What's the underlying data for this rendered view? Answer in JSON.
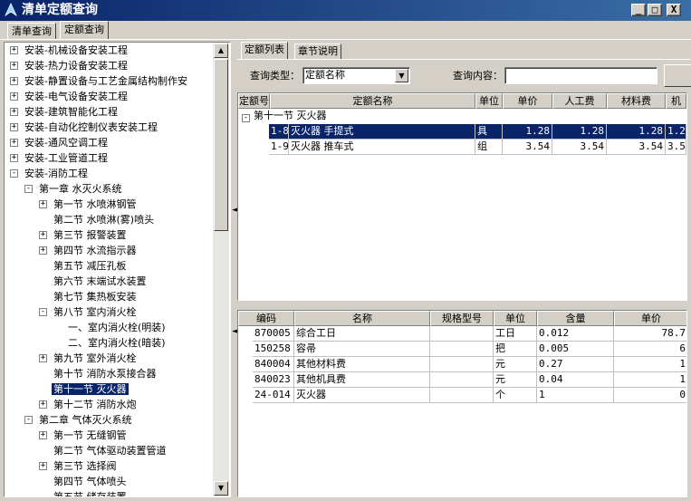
{
  "window": {
    "title": "清单定额查询",
    "buttons": {
      "minimize": "_",
      "maximize": "□",
      "close": "X"
    }
  },
  "top_tabs": [
    "清单查询",
    "定额查询"
  ],
  "tree": {
    "items": [
      {
        "label": "安装-机械设备安装工程",
        "level": 0,
        "exp": "+"
      },
      {
        "label": "安装-热力设备安装工程",
        "level": 0,
        "exp": "+"
      },
      {
        "label": "安装-静置设备与工艺金属结构制作安",
        "level": 0,
        "exp": "+"
      },
      {
        "label": "安装-电气设备安装工程",
        "level": 0,
        "exp": "+"
      },
      {
        "label": "安装-建筑智能化工程",
        "level": 0,
        "exp": "+"
      },
      {
        "label": "安装-自动化控制仪表安装工程",
        "level": 0,
        "exp": "+"
      },
      {
        "label": "安装-通风空调工程",
        "level": 0,
        "exp": "+"
      },
      {
        "label": "安装-工业管道工程",
        "level": 0,
        "exp": "+"
      },
      {
        "label": "安装-消防工程",
        "level": 0,
        "exp": "-"
      },
      {
        "label": "第一章 水灭火系统",
        "level": 1,
        "exp": "-"
      },
      {
        "label": "第一节 水喷淋钢管",
        "level": 2,
        "exp": "+"
      },
      {
        "label": "第二节 水喷淋(雾)喷头",
        "level": 2,
        "exp": ""
      },
      {
        "label": "第三节 报警装置",
        "level": 2,
        "exp": "+"
      },
      {
        "label": "第四节 水流指示器",
        "level": 2,
        "exp": "+"
      },
      {
        "label": "第五节 减压孔板",
        "level": 2,
        "exp": ""
      },
      {
        "label": "第六节 末端试水装置",
        "level": 2,
        "exp": ""
      },
      {
        "label": "第七节 集热板安装",
        "level": 2,
        "exp": ""
      },
      {
        "label": "第八节 室内消火栓",
        "level": 2,
        "exp": "-"
      },
      {
        "label": "一、室内消火栓(明装)",
        "level": 3,
        "exp": ""
      },
      {
        "label": "二、室内消火栓(暗装)",
        "level": 3,
        "exp": ""
      },
      {
        "label": "第九节 室外消火栓",
        "level": 2,
        "exp": "+"
      },
      {
        "label": "第十节 消防水泵接合器",
        "level": 2,
        "exp": ""
      },
      {
        "label": "第十一节 灭火器",
        "level": 2,
        "exp": "",
        "selected": true
      },
      {
        "label": "第十二节 消防水炮",
        "level": 2,
        "exp": "+"
      },
      {
        "label": "第二章 气体灭火系统",
        "level": 1,
        "exp": "-"
      },
      {
        "label": "第一节 无缝钢管",
        "level": 2,
        "exp": "+"
      },
      {
        "label": "第二节 气体驱动装置管道",
        "level": 2,
        "exp": ""
      },
      {
        "label": "第三节 选择阀",
        "level": 2,
        "exp": "+"
      },
      {
        "label": "第四节 气体喷头",
        "level": 2,
        "exp": ""
      },
      {
        "label": "第五节 储存装置",
        "level": 2,
        "exp": ""
      }
    ]
  },
  "right_tabs": [
    "定额列表",
    "章节说明"
  ],
  "query": {
    "type_label": "查询类型：",
    "type_value": "定额名称",
    "content_label": "查询内容：",
    "content_value": ""
  },
  "quota_grid": {
    "headers": [
      "定额号",
      "定额名称",
      "单位",
      "单价",
      "人工费",
      "材料费",
      "机"
    ],
    "group_label": "第十一节 灭火器",
    "rows": [
      {
        "code": "1-8",
        "name": "灭火器 手提式",
        "unit": "具",
        "price": "1.28",
        "labor": "1.28",
        "material": "1.28",
        "machine": "1.2",
        "selected": true
      },
      {
        "code": "1-9",
        "name": "灭火器 推车式",
        "unit": "组",
        "price": "3.54",
        "labor": "3.54",
        "material": "3.54",
        "machine": "3.5",
        "selected": false
      }
    ]
  },
  "material_grid": {
    "headers": [
      "编码",
      "名称",
      "规格型号",
      "单位",
      "含量",
      "单价"
    ],
    "rows": [
      {
        "code": "870005",
        "name": "综合工日",
        "spec": "",
        "unit": "工日",
        "qty": "0.012",
        "price": "78.7"
      },
      {
        "code": "150258",
        "name": "容帚",
        "spec": "",
        "unit": "把",
        "qty": "0.005",
        "price": "6"
      },
      {
        "code": "840004",
        "name": "其他材料费",
        "spec": "",
        "unit": "元",
        "qty": "0.27",
        "price": "1"
      },
      {
        "code": "840023",
        "name": "其他机具费",
        "spec": "",
        "unit": "元",
        "qty": "0.04",
        "price": "1"
      },
      {
        "code": "24-014",
        "name": "灭火器",
        "spec": "",
        "unit": "个",
        "qty": "1",
        "price": "0"
      }
    ]
  },
  "icons": {
    "app": "app-logo-icon",
    "up": "▲",
    "down": "▼",
    "left": "◄",
    "combo": "▼"
  }
}
